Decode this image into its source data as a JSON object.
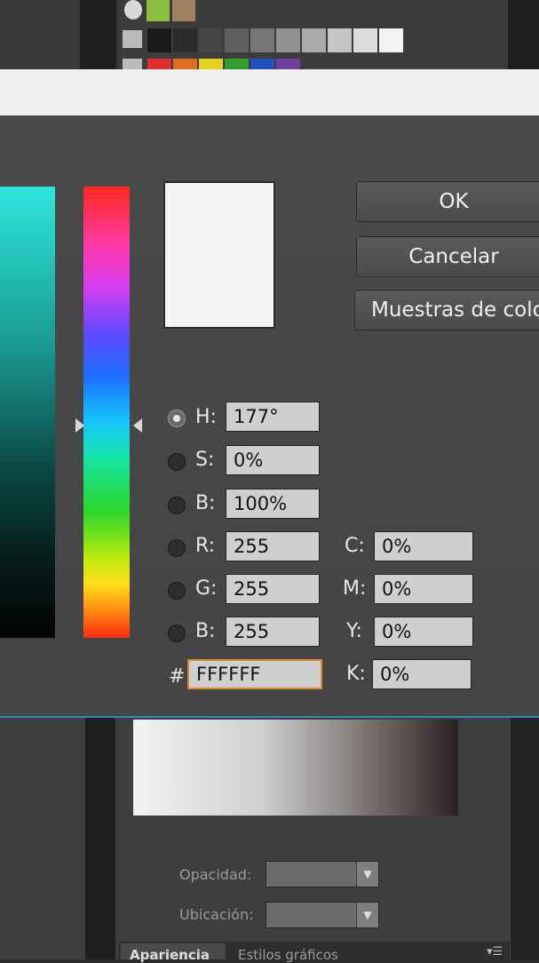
{
  "dialog": {
    "buttons": {
      "ok": "OK",
      "cancel": "Cancelar",
      "swatches": "Muestras de colo"
    },
    "fields": {
      "h": {
        "label": "H:",
        "value": "177°",
        "selected": true
      },
      "s": {
        "label": "S:",
        "value": "0%"
      },
      "b": {
        "label": "B:",
        "value": "100%"
      },
      "r": {
        "label": "R:",
        "value": "255"
      },
      "g": {
        "label": "G:",
        "value": "255"
      },
      "b2": {
        "label": "B:",
        "value": "255"
      },
      "hex": {
        "label": "#",
        "value": "FFFFFF"
      },
      "c": {
        "label": "C:",
        "value": "0%"
      },
      "m": {
        "label": "M:",
        "value": "0%"
      },
      "y": {
        "label": "Y:",
        "value": "0%"
      },
      "k": {
        "label": "K:",
        "value": "0%"
      }
    },
    "preview_color": "#FFFFFF"
  },
  "panel": {
    "opacity_label": "Opacidad:",
    "location_label": "Ubicación:"
  },
  "tabs": [
    {
      "label": "Apariencia",
      "active": true
    },
    {
      "label": "Estilos gráficos",
      "active": false
    }
  ],
  "swatch_colors": {
    "grays": [
      "#1a1a1a",
      "#2b2b2b",
      "#444444",
      "#5e5e5e",
      "#777777",
      "#919191",
      "#aaaaaa",
      "#c4c4c4",
      "#dddddd",
      "#f4f4f4"
    ],
    "row": [
      "#e03030",
      "#e07020",
      "#e8d020",
      "#30a030",
      "#2050c0",
      "#7040a0"
    ]
  }
}
